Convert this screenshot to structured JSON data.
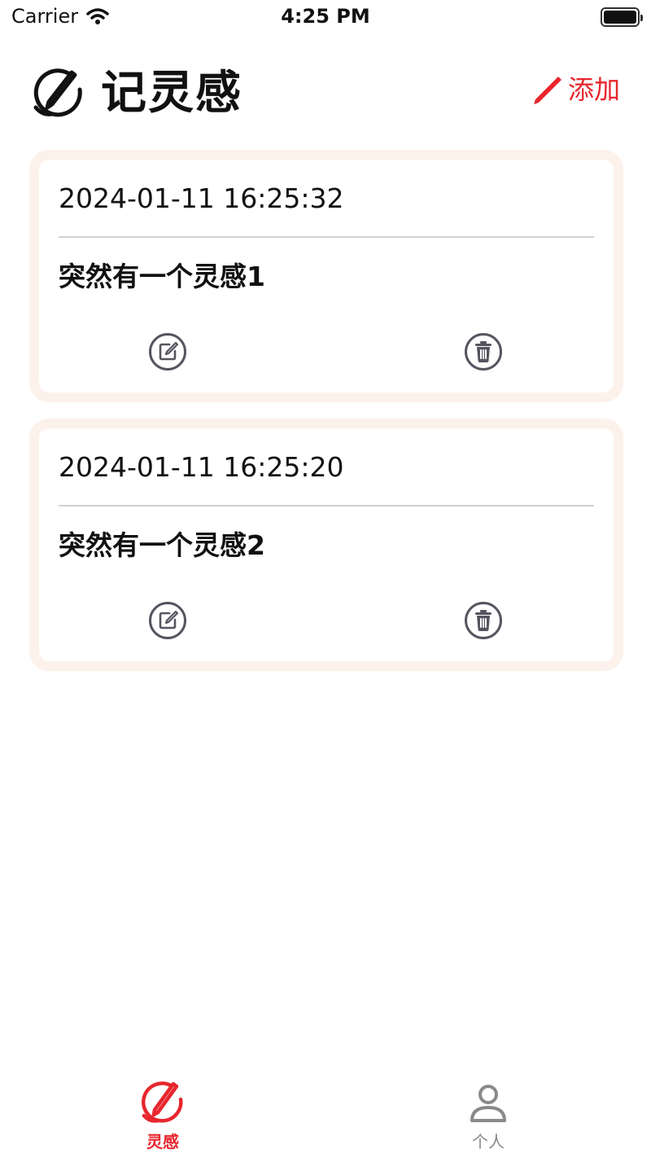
{
  "status_bar": {
    "carrier": "Carrier",
    "time": "4:25 PM"
  },
  "header": {
    "title": "记灵感",
    "add_label": "添加"
  },
  "notes": [
    {
      "date": "2024-01-11 16:25:32",
      "text": "突然有一个灵感1"
    },
    {
      "date": "2024-01-11 16:25:20",
      "text": "突然有一个灵感2"
    }
  ],
  "tab_bar": {
    "tabs": [
      {
        "label": "灵感",
        "icon": "pencil-circle-icon",
        "active": true
      },
      {
        "label": "个人",
        "icon": "person-icon",
        "active": false
      }
    ]
  },
  "colors": {
    "accent": "#e8262d",
    "card_border": "#fdf1ec",
    "icon_gray": "#555560",
    "inactive_tab": "#888888"
  }
}
